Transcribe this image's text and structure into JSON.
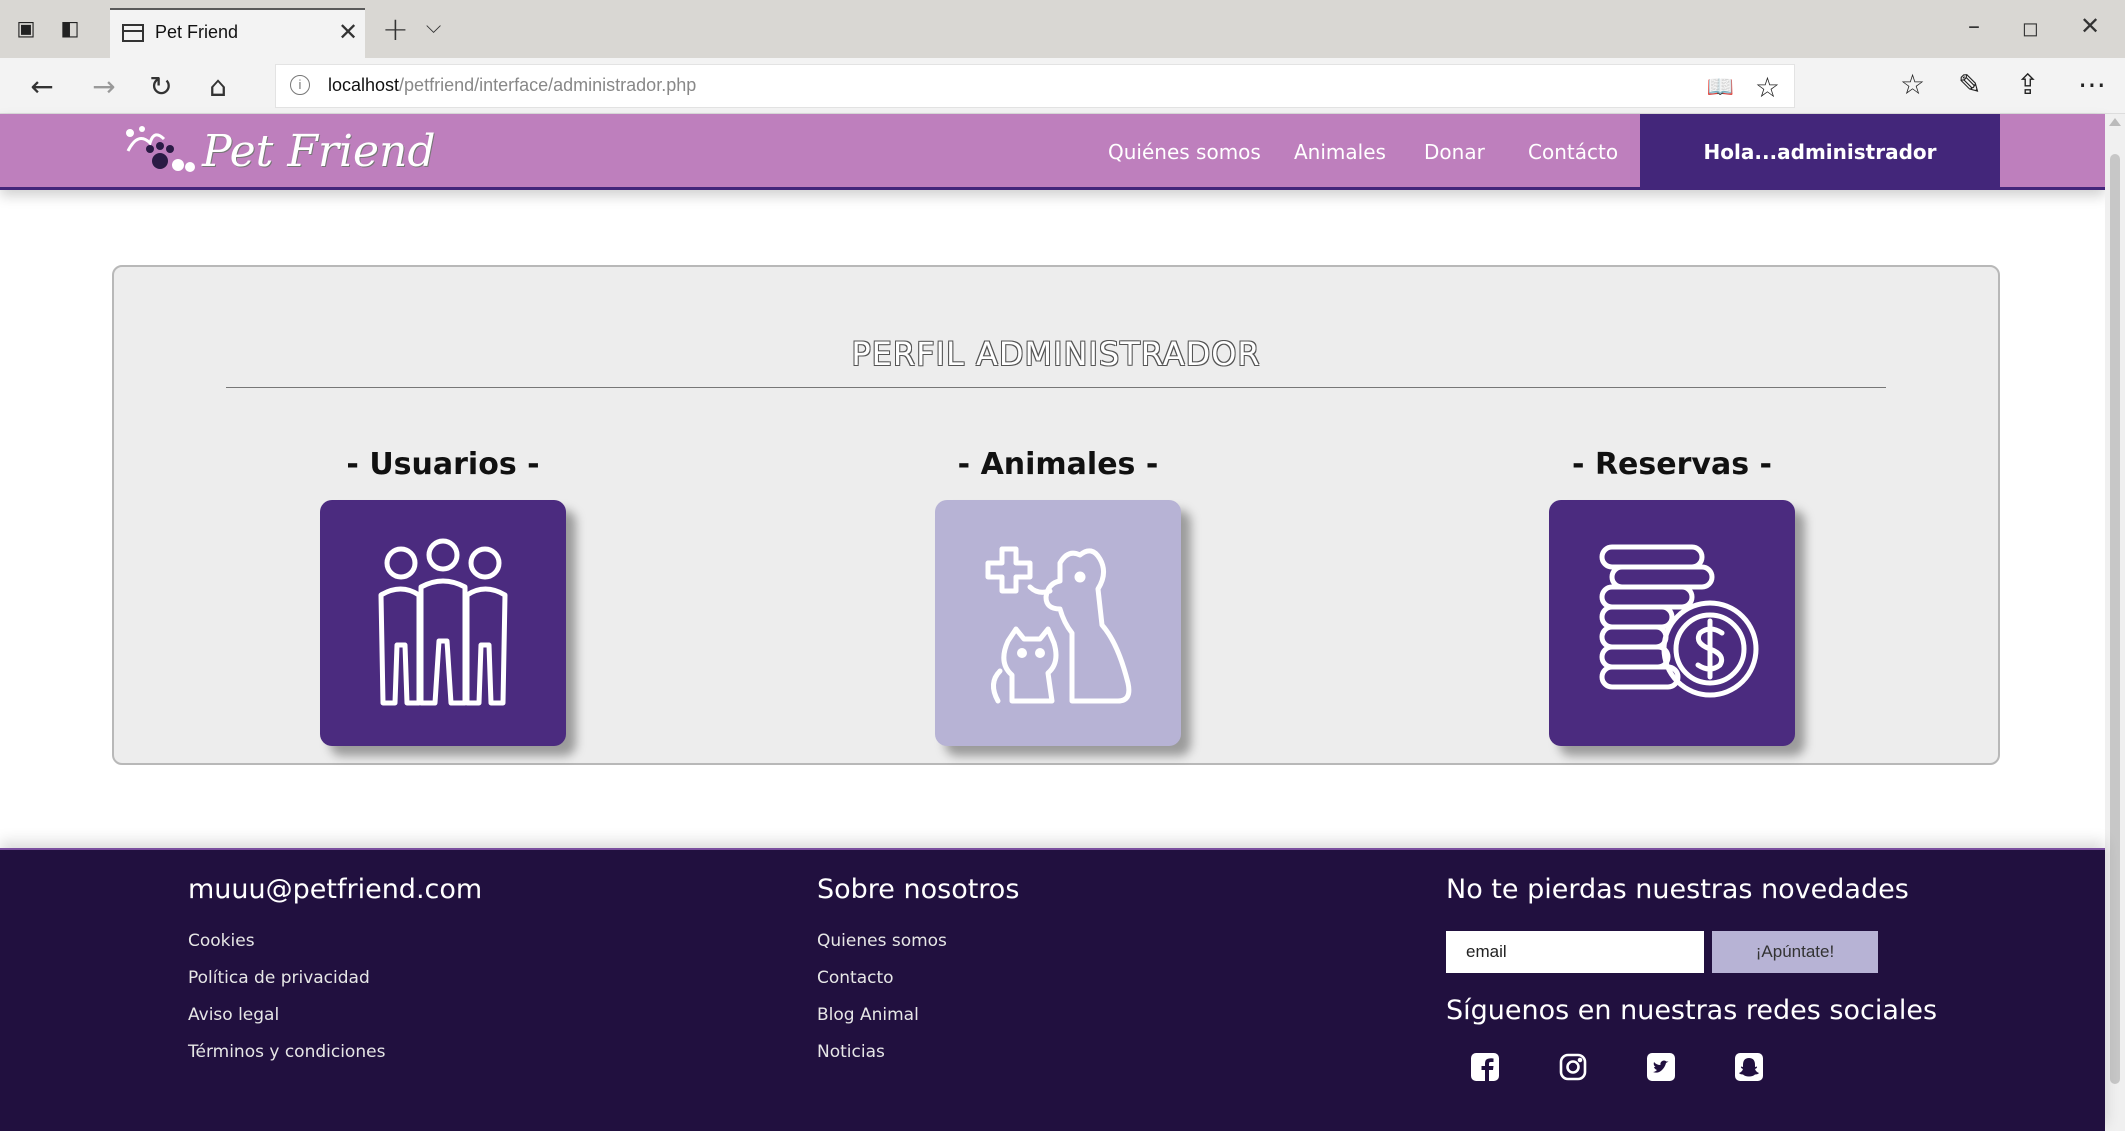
{
  "browser": {
    "tab_title": "Pet Friend",
    "url_host": "localhost",
    "url_path": "/petfriend/interface/administrador.php"
  },
  "site": {
    "logo_text": "Pet Friend",
    "menu": [
      "Quiénes somos",
      "Animales",
      "Donar",
      "Contácto"
    ],
    "user_greeting": "Hola...administrador"
  },
  "panel": {
    "title": "PERFIL ADMINISTRADOR",
    "cards": [
      {
        "label": "- Usuarios -",
        "icon": "users-icon"
      },
      {
        "label": "- Animales -",
        "icon": "pets-icon"
      },
      {
        "label": "- Reservas -",
        "icon": "coins-icon"
      }
    ]
  },
  "footer": {
    "col1": {
      "heading": "muuu@petfriend.com",
      "links": [
        "Cookies",
        "Política de privacidad",
        "Aviso legal",
        "Términos y condiciones"
      ]
    },
    "col2": {
      "heading": "Sobre nosotros",
      "links": [
        "Quienes somos",
        "Contacto",
        "Blog Animal",
        "Noticias"
      ]
    },
    "col3": {
      "heading": "No te pierdas nuestras novedades",
      "email_value": "email",
      "subscribe_label": "¡Apúntate!",
      "social_heading": "Síguenos en nuestras redes sociales",
      "social_icons": [
        "facebook-icon",
        "instagram-icon",
        "twitter-icon",
        "snapchat-icon"
      ]
    }
  },
  "colors": {
    "header": "#be7fbd",
    "accent": "#43267a",
    "tile_dark": "#4b2b7f",
    "tile_light": "#b7b3d5",
    "footer": "#21103f"
  }
}
